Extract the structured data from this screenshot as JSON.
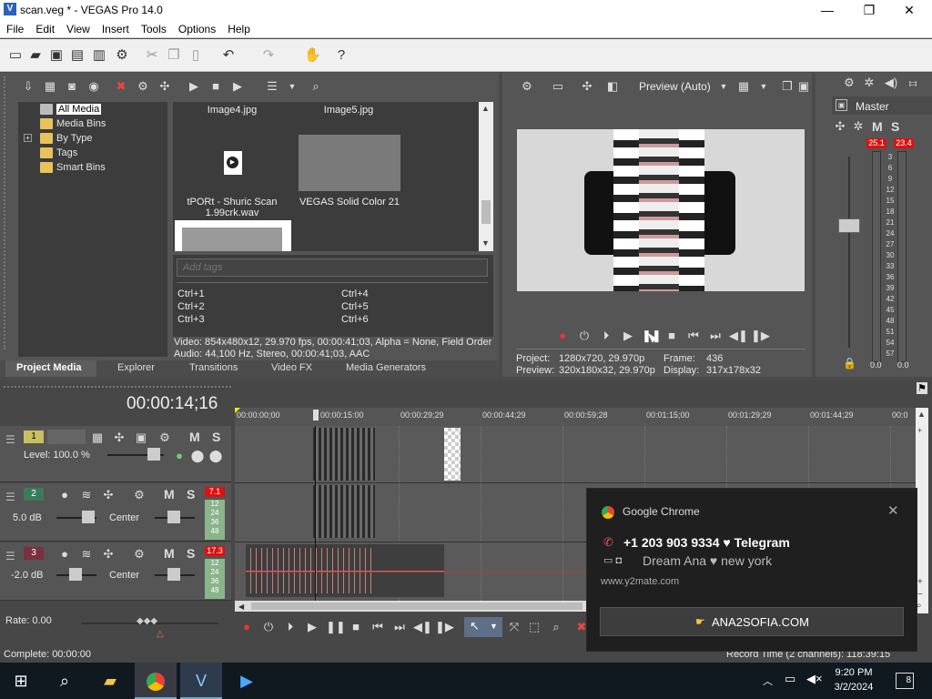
{
  "window": {
    "title": "scan.veg * - VEGAS Pro 14.0",
    "min_icon": "minimize-icon",
    "max_icon": "maximize-icon",
    "close_icon": "close-icon"
  },
  "menu": [
    "File",
    "Edit",
    "View",
    "Insert",
    "Tools",
    "Options",
    "Help"
  ],
  "project_media": {
    "tree": [
      "All Media",
      "Media Bins",
      "By Type",
      "Tags",
      "Smart Bins"
    ],
    "files": {
      "img4": "Image4.jpg",
      "img5": "Image5.jpg",
      "wav": "tPORt - Shuric Scan 1.99crk.wav",
      "solid": "VEGAS Solid Color 21"
    },
    "tags_placeholder": "Add tags",
    "shortcuts": [
      "Ctrl+1",
      "Ctrl+2",
      "Ctrl+3",
      "Ctrl+4",
      "Ctrl+5",
      "Ctrl+6"
    ],
    "info_video": "Video: 854x480x12, 29.970 fps, 00:00:41;03, Alpha = None, Field Order",
    "info_audio": "Audio: 44,100 Hz, Stereo, 00:00:41;03, AAC",
    "tabs": [
      "Project Media",
      "Explorer",
      "Transitions",
      "Video FX",
      "Media Generators"
    ]
  },
  "preview": {
    "mode": "Preview (Auto)",
    "project_label": "Project:",
    "project_val": "1280x720, 29.970p",
    "preview_label": "Preview:",
    "preview_val": "320x180x32, 29.970p",
    "frame_label": "Frame:",
    "frame_val": "436",
    "display_label": "Display:",
    "display_val": "317x178x32"
  },
  "master": {
    "label": "Master",
    "m": "M",
    "s": "S",
    "peak_l": "25.1",
    "peak_r": "23.4",
    "scale": [
      "3",
      "6",
      "9",
      "12",
      "15",
      "18",
      "21",
      "24",
      "27",
      "30",
      "33",
      "36",
      "39",
      "42",
      "45",
      "48",
      "51",
      "54",
      "57"
    ],
    "level_l": "0.0",
    "level_r": "0.0"
  },
  "timeline": {
    "timecode": "00:00:14;16",
    "ruler": [
      "00:00:00;00",
      "00:00:15:00",
      "00:00:29;29",
      "00:00:44;29",
      "00:00:59;28",
      "00:01:15;00",
      "00:01:29;29",
      "00:01:44;29",
      "00:0"
    ],
    "track1": {
      "num": "1",
      "level": "Level: 100.0 %",
      "m": "M",
      "s": "S"
    },
    "track2": {
      "num": "2",
      "vol": "5.0 dB",
      "pan": "Center",
      "m": "M",
      "s": "S",
      "peak": "7.1"
    },
    "track3": {
      "num": "3",
      "vol": "-2.0 dB",
      "pan": "Center",
      "m": "M",
      "s": "S",
      "peak": "17.3"
    },
    "meter_ticks": [
      "12",
      "24",
      "36",
      "48"
    ],
    "rate": "Rate: 0.00",
    "complete": "Complete: 00:00:00",
    "record_time": "Record Time (2 channels): 118:39:15"
  },
  "toast": {
    "app": "Google Chrome",
    "line1": "+1 203 903 9334 ♥ Telegram",
    "line2": "Dream Ana ♥ new york",
    "source": "www.y2mate.com",
    "button": "ANA2SOFIA.COM"
  },
  "taskbar": {
    "time": "9:20 PM",
    "date": "3/2/2024",
    "notif_count": "8"
  }
}
